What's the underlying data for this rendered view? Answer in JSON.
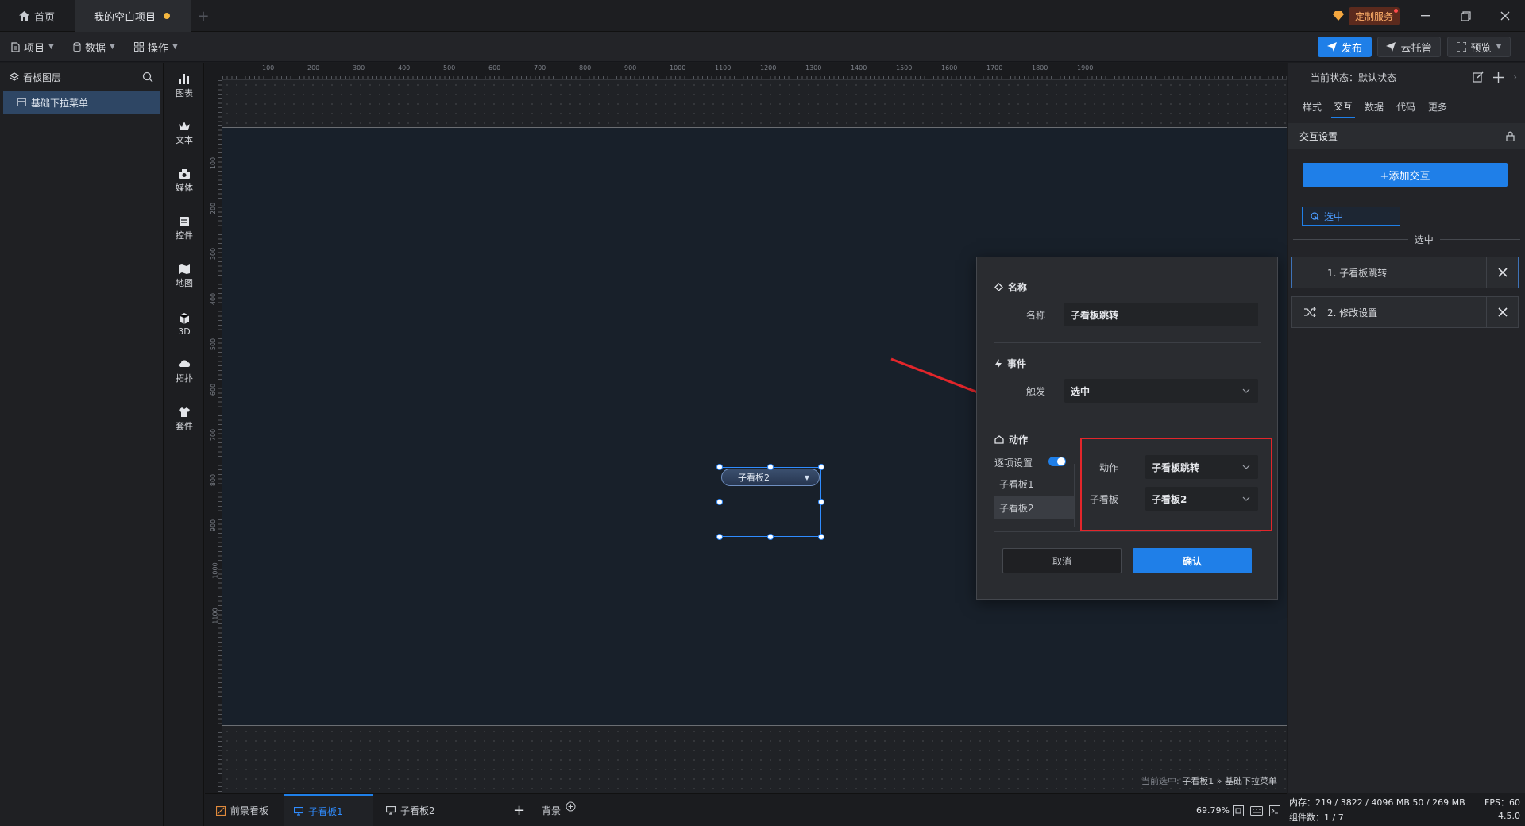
{
  "titlebar": {
    "home_tab": "首页",
    "project_tab": "我的空白项目",
    "add_tab": "+",
    "custom_service": "定制服务"
  },
  "toolbar": {
    "menu_project": "项目",
    "menu_data": "数据",
    "menu_operate": "操作",
    "publish": "发布",
    "cloud_host": "云托管",
    "preview": "预览"
  },
  "layers": {
    "title": "看板图层",
    "items": [
      "基础下拉菜单"
    ]
  },
  "rail": {
    "items": [
      "图表",
      "文本",
      "媒体",
      "控件",
      "地图",
      "3D",
      "拓扑",
      "套件"
    ]
  },
  "canvas": {
    "ruler_top": [
      "100",
      "200",
      "300",
      "400",
      "500",
      "600",
      "700",
      "800",
      "900",
      "1000",
      "1100",
      "1200",
      "1300",
      "1400",
      "1500",
      "1600",
      "1700",
      "1800",
      "1900"
    ],
    "ruler_left": [
      "100",
      "200",
      "300",
      "400",
      "500",
      "600",
      "700",
      "800",
      "900",
      "1000",
      "1100"
    ],
    "widget_text": "子看板2",
    "status_prefix": "当前选中:",
    "status_path": "子看板1 » 基础下拉菜单"
  },
  "modal": {
    "section_name": "名称",
    "name_label": "名称",
    "name_value": "子看板跳转",
    "section_event": "事件",
    "trigger_label": "触发",
    "trigger_value": "选中",
    "section_action": "动作",
    "per_item_label": "逐项设置",
    "options": [
      "子看板1",
      "子看板2"
    ],
    "action_label": "动作",
    "action_value": "子看板跳转",
    "subboard_label": "子看板",
    "subboard_value": "子看板2",
    "cancel": "取消",
    "confirm": "确认"
  },
  "props": {
    "state_label": "当前状态：",
    "state_value": "默认状态",
    "tabs": [
      "样式",
      "交互",
      "数据",
      "代码",
      "更多"
    ],
    "active_tab": "交互",
    "interaction_title": "交互设置",
    "add_interaction": "+添加交互",
    "event_tag": "选中",
    "event_divider": "选中",
    "actions": [
      "1. 子看板跳转",
      "2. 修改设置"
    ]
  },
  "bottombar": {
    "tabs": [
      "前景看板",
      "子看板1",
      "子看板2"
    ],
    "add": "+",
    "background": "背景",
    "zoom": "69.79%"
  },
  "stats": {
    "memory": "内存：219 / 3822 / 4096 MB  50 / 269 MB",
    "fps": "FPS：60",
    "components": "组件数：1 / 7",
    "version": "4.5.0"
  },
  "colors": {
    "accent": "#1f7fe8",
    "highlight": "#e3262b",
    "unsaved_dot": "#f4b73f"
  }
}
